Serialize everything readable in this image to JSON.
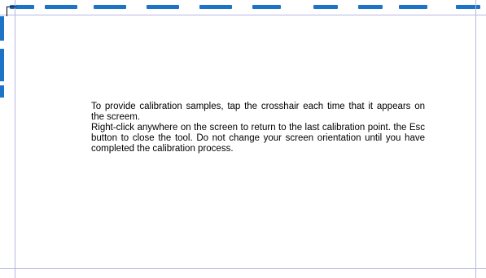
{
  "instructions": {
    "line1": "To provide calibration samples, tap the crosshair each time that it appears on the screem.",
    "line2": "Right-click anywhere on the screen to return to the last calibration point. the Esc button to close the tool. Do not change your screen orientation until you have completed the calibration process."
  },
  "colors": {
    "guide_line": "#b8b8e0",
    "accent_blue": "#1d74c6",
    "background": "#ffffff"
  },
  "icons": {
    "crosshair": "crosshair-icon"
  }
}
